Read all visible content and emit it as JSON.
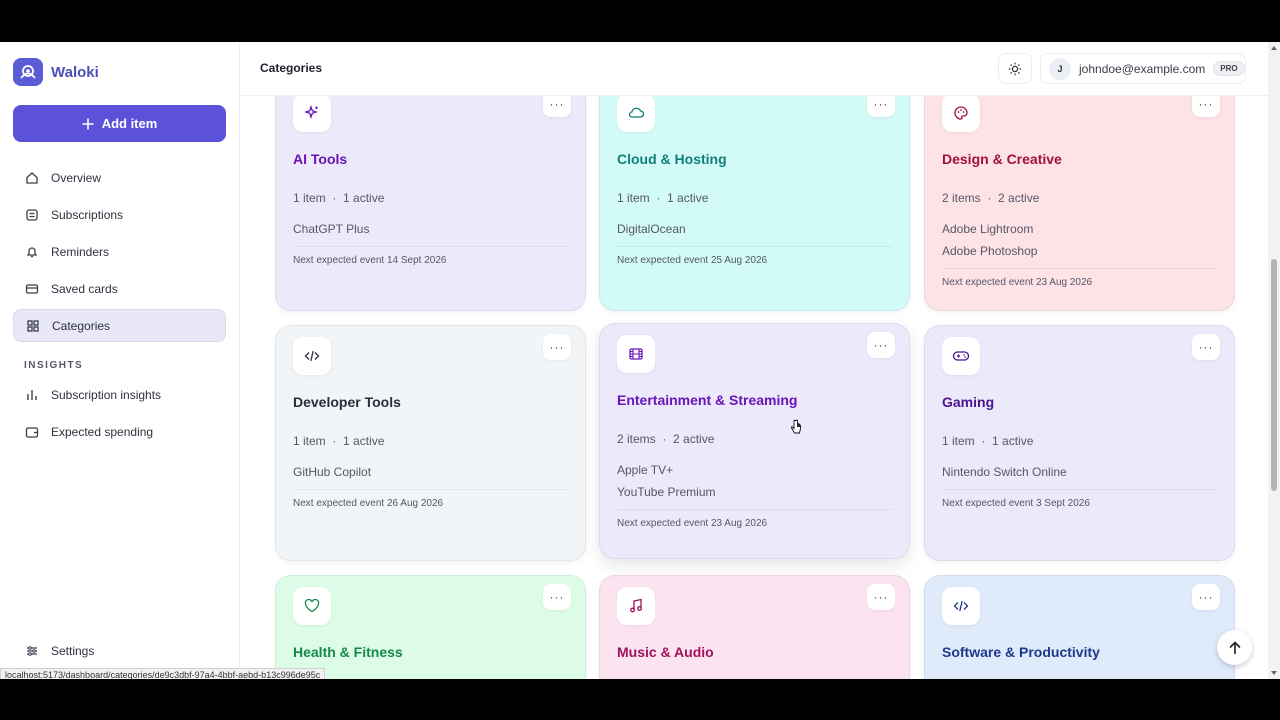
{
  "brand": {
    "name": "Waloki"
  },
  "sidebar": {
    "add_label": "Add item",
    "items": [
      {
        "label": "Overview",
        "icon": "home-icon"
      },
      {
        "label": "Subscriptions",
        "icon": "list-icon"
      },
      {
        "label": "Reminders",
        "icon": "bell-icon"
      },
      {
        "label": "Saved cards",
        "icon": "credit-card-icon"
      },
      {
        "label": "Categories",
        "icon": "grid-icon",
        "active": true
      }
    ],
    "section_label": "INSIGHTS",
    "insights": [
      {
        "label": "Subscription insights",
        "icon": "bar-chart-icon"
      },
      {
        "label": "Expected spending",
        "icon": "wallet-icon"
      }
    ],
    "settings_label": "Settings"
  },
  "header": {
    "title": "Categories",
    "user_initial": "J",
    "user_email": "johndoe@example.com",
    "badge": "PRO"
  },
  "cards": [
    {
      "title": "AI Tools",
      "meta_count": "1 item",
      "meta_active": "1 active",
      "items": [
        "ChatGPT Plus"
      ],
      "footer": "Next expected event 14 Sept 2026",
      "icon": "sparkles-icon",
      "bg": "#ece9fb",
      "title_color": "#6a14b8"
    },
    {
      "title": "Cloud & Hosting",
      "meta_count": "1 item",
      "meta_active": "1 active",
      "items": [
        "DigitalOcean"
      ],
      "footer": "Next expected event 25 Aug 2026",
      "icon": "cloud-icon",
      "bg": "#d2faf6",
      "title_color": "#0f7f7a"
    },
    {
      "title": "Design & Creative",
      "meta_count": "2 items",
      "meta_active": "2 active",
      "items": [
        "Adobe Lightroom",
        "Adobe Photoshop"
      ],
      "footer": "Next expected event 23 Aug 2026",
      "icon": "palette-icon",
      "bg": "#fde3e5",
      "title_color": "#a0123a"
    },
    {
      "title": "Developer Tools",
      "meta_count": "1 item",
      "meta_active": "1 active",
      "items": [
        "GitHub Copilot"
      ],
      "footer": "Next expected event 26 Aug 2026",
      "icon": "code-icon",
      "bg": "#f1f5f7",
      "title_color": "#2b2d3a"
    },
    {
      "title": "Entertainment & Streaming",
      "meta_count": "2 items",
      "meta_active": "2 active",
      "items": [
        "Apple TV+",
        "YouTube Premium"
      ],
      "footer": "Next expected event 23 Aug 2026",
      "icon": "film-icon",
      "bg": "#ebe9fa",
      "title_color": "#6a14b8"
    },
    {
      "title": "Gaming",
      "meta_count": "1 item",
      "meta_active": "1 active",
      "items": [
        "Nintendo Switch Online"
      ],
      "footer": "Next expected event 3 Sept 2026",
      "icon": "gamepad-icon",
      "bg": "#ebe9fa",
      "title_color": "#4a138f"
    },
    {
      "title": "Health & Fitness",
      "meta_count": "",
      "meta_active": "",
      "items": [],
      "footer": "",
      "icon": "heart-icon",
      "bg": "#dcfce7",
      "title_color": "#17874a"
    },
    {
      "title": "Music & Audio",
      "meta_count": "",
      "meta_active": "",
      "items": [],
      "footer": "",
      "icon": "music-icon",
      "bg": "#fbe3ef",
      "title_color": "#a0125e"
    },
    {
      "title": "Software & Productivity",
      "meta_count": "",
      "meta_active": "",
      "items": [],
      "footer": "",
      "icon": "code-icon",
      "bg": "#dfeafb",
      "title_color": "#1d3a8a"
    }
  ],
  "menu_glyph": "···",
  "status_url": "localhost:5173/dashboard/categories/de9c3dbf-97a4-4bbf-aebd-b13c996de95c"
}
